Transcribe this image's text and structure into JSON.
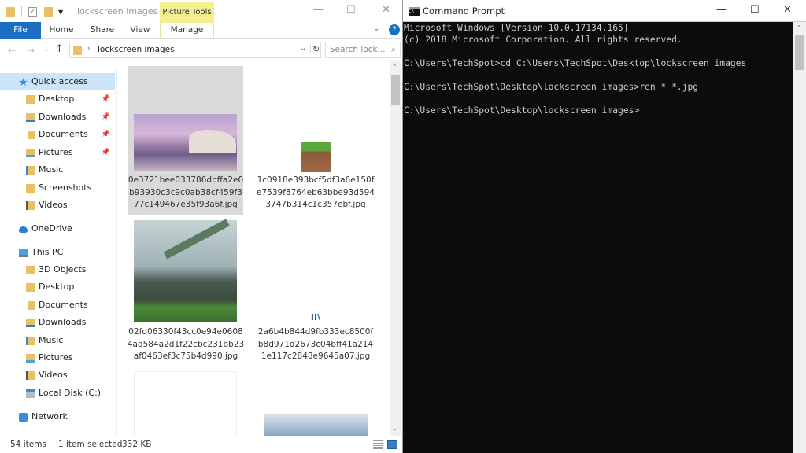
{
  "explorer": {
    "title": "lockscreen images",
    "contextual_tab": "Picture Tools",
    "tabs": [
      "File",
      "Home",
      "Share",
      "View",
      "Manage"
    ],
    "address": "lockscreen images",
    "search_placeholder": "Search lock...",
    "nav": [
      {
        "label": "Quick access",
        "icon": "star-icon",
        "selected": true
      },
      {
        "label": "Desktop",
        "icon": "folder-icon",
        "pinned": true
      },
      {
        "label": "Downloads",
        "icon": "download-icon",
        "pinned": true
      },
      {
        "label": "Documents",
        "icon": "document-icon",
        "pinned": true
      },
      {
        "label": "Pictures",
        "icon": "pictures-icon",
        "pinned": true
      },
      {
        "label": "Music",
        "icon": "music-icon"
      },
      {
        "label": "Screenshots",
        "icon": "folder-icon"
      },
      {
        "label": "Videos",
        "icon": "video-icon"
      },
      {
        "label": "OneDrive",
        "icon": "cloud-icon"
      },
      {
        "label": "This PC",
        "icon": "computer-icon"
      },
      {
        "label": "3D Objects",
        "icon": "folder-icon"
      },
      {
        "label": "Desktop",
        "icon": "folder-icon"
      },
      {
        "label": "Documents",
        "icon": "document-icon"
      },
      {
        "label": "Downloads",
        "icon": "download-icon"
      },
      {
        "label": "Music",
        "icon": "music-icon"
      },
      {
        "label": "Pictures",
        "icon": "pictures-icon"
      },
      {
        "label": "Videos",
        "icon": "video-icon"
      },
      {
        "label": "Local Disk (C:)",
        "icon": "drive-icon"
      },
      {
        "label": "Network",
        "icon": "network-icon"
      }
    ],
    "files": [
      {
        "name": [
          "0e3721bee033786dbffa2e0",
          "b93930c3c9c0ab38cf459f3",
          "77c149467e35f93a6f.jpg"
        ],
        "selected": true
      },
      {
        "name": [
          "1c0918e393bcf5df3a6e150f",
          "e7539f8764eb63bbe93d594",
          "3747b314c1c357ebf.jpg"
        ]
      },
      {
        "name": [
          "02fd06330f43cc0e94e0608",
          "4ad584a2d1f22cbc231bb23",
          "af0463ef3c75b4d990.jpg"
        ]
      },
      {
        "name": [
          "2a6b4b844d9fb333ec8500f",
          "b8d971d2673c04bff41a214",
          "1e117c2848e9645a07.jpg"
        ]
      }
    ],
    "status": {
      "count": "54 items",
      "selection": "1 item selected",
      "size": "332 KB"
    }
  },
  "cmd": {
    "title": "Command Prompt",
    "lines": [
      "Microsoft Windows [Version 10.0.17134.165]",
      "(c) 2018 Microsoft Corporation. All rights reserved.",
      "",
      "C:\\Users\\TechSpot>cd C:\\Users\\TechSpot\\Desktop\\lockscreen images",
      "",
      "C:\\Users\\TechSpot\\Desktop\\lockscreen images>ren * *.jpg",
      "",
      "C:\\Users\\TechSpot\\Desktop\\lockscreen images>"
    ]
  },
  "colors": {
    "accent": "#1a6fc4",
    "picture_tools": "#f4f092",
    "selection": "#cce4f7"
  }
}
